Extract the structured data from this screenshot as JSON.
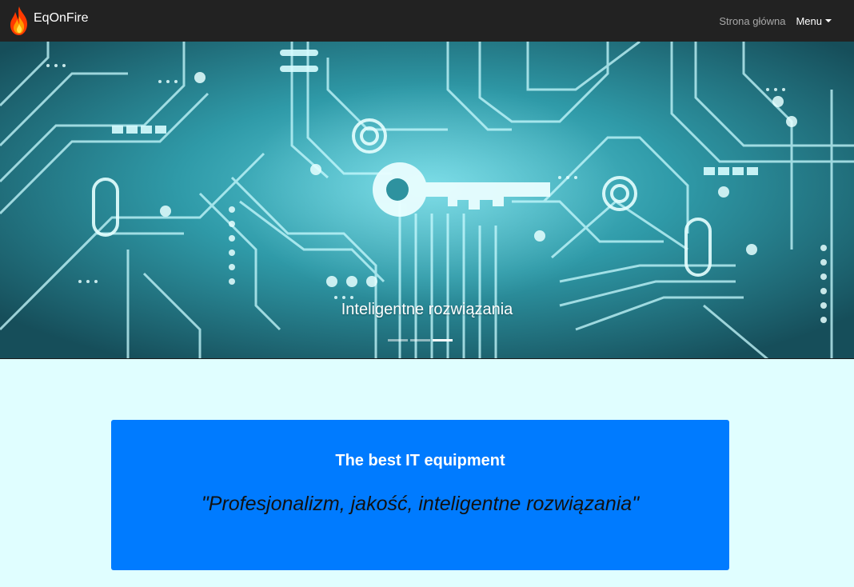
{
  "navbar": {
    "brand": "EqOnFire",
    "logo_icon": "flame-icon",
    "links": [
      {
        "label": "Strona główna"
      },
      {
        "label": "Menu"
      }
    ],
    "background": "#222222"
  },
  "carousel": {
    "caption": "Inteligentne rozwiązania",
    "slide_count": 3,
    "active_slide": 3
  },
  "card": {
    "title": "The best IT equipment",
    "quote": "\"Profesjonalizm, jakość, inteligentne rozwiązania\"",
    "background": "#007bff"
  },
  "page": {
    "background": "#e0feff"
  }
}
